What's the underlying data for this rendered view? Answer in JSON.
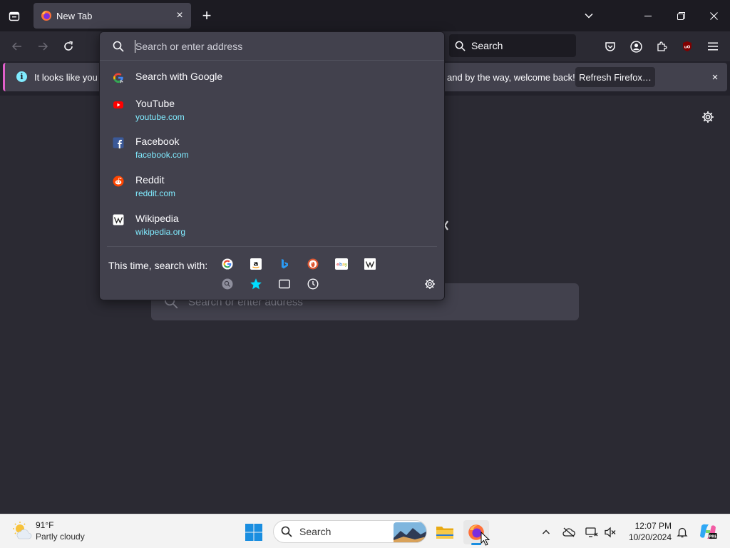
{
  "tab": {
    "title": "New Tab",
    "close_label": "×"
  },
  "newtab_label": "+",
  "navbar": {
    "search_placeholder": "Search"
  },
  "notification": {
    "text_start": "It looks like you ha",
    "text_end": "and by the way, welcome back!",
    "button": "Refresh Firefox…",
    "close": "×"
  },
  "urlbar": {
    "placeholder": "Search or enter address",
    "search_with": "Search with Google",
    "results": [
      {
        "name": "YouTube",
        "url": "youtube.com"
      },
      {
        "name": "Facebook",
        "url": "facebook.com"
      },
      {
        "name": "Reddit",
        "url": "reddit.com"
      },
      {
        "name": "Wikipedia",
        "url": "wikipedia.org"
      }
    ],
    "oneoff_label": "This time, search with:",
    "engines": [
      "google-icon",
      "amazon-icon",
      "bing-icon",
      "duckduckgo-icon",
      "ebay-icon",
      "wikipedia-icon"
    ],
    "modes": [
      "search-icon",
      "bookmarks-icon",
      "tabs-icon",
      "history-icon"
    ]
  },
  "page": {
    "search_placeholder": "Search or enter address"
  },
  "taskbar": {
    "weather_temp": "91°F",
    "weather_cond": "Partly cloudy",
    "search_label": "Search",
    "time": "12:07 PM",
    "date": "10/20/2024"
  },
  "colors": {
    "accent": "#80ebff",
    "panel": "#42414d",
    "toolbar": "#2b2a33",
    "tabstrip": "#1c1b22"
  }
}
